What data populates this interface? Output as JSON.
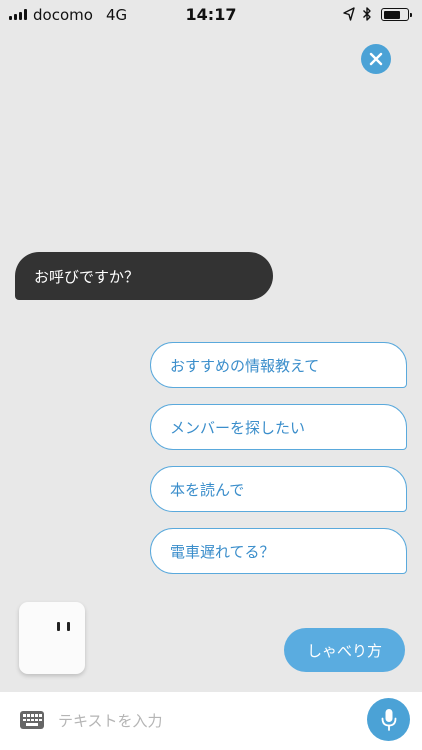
{
  "status_bar": {
    "carrier": "docomo",
    "network": "4G",
    "time": "14:17",
    "battery_level": 0.75
  },
  "chat": {
    "bot_message": "お呼びですか？",
    "suggestions": [
      "おすすめの情報教えて",
      "メンバーを探したい",
      "本を読んで",
      "電車遅れてる？"
    ]
  },
  "howto_button_label": "しゃべり方",
  "input": {
    "placeholder": "テキストを入力"
  },
  "colors": {
    "accent": "#4ba2d6",
    "background": "#e8e8e8",
    "bot_bubble": "#333333",
    "suggestion_text": "#3b8ecb"
  }
}
